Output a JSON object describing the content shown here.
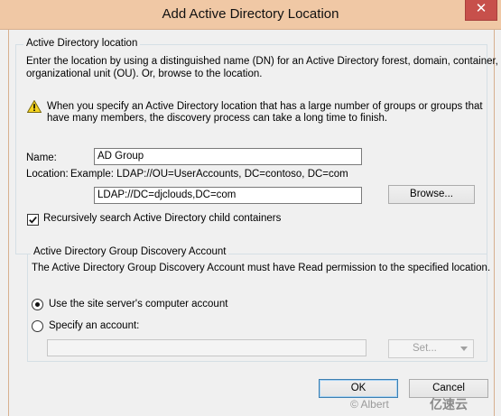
{
  "window": {
    "title": "Add Active Directory Location",
    "close_glyph": "✕"
  },
  "location_group": {
    "legend": "Active Directory location",
    "description_line1": "Enter the location by using a distinguished name (DN) for an Active Directory forest, domain, container, or",
    "description_line2": "organizational unit (OU). Or, browse to the location.",
    "warning_line1": "When you specify an Active Directory location that has a large number of groups or groups that",
    "warning_line2": "have many members, the discovery process can take a long time to finish.",
    "warning_icon": "warning-icon",
    "name_label": "Name:",
    "name_value": "AD Group",
    "location_label": "Location:",
    "location_example": "Example: LDAP://OU=UserAccounts, DC=contoso, DC=com",
    "location_value": "LDAP://DC=djclouds,DC=com",
    "browse_label": "Browse...",
    "recursive_label": "Recursively search Active Directory child containers",
    "recursive_checked": true
  },
  "account_group": {
    "legend": "Active Directory Group Discovery Account",
    "description": "The Active Directory Group Discovery Account must have Read permission to the specified location.",
    "option_site_server": "Use the site server's computer account",
    "option_specify": "Specify an account:",
    "selected": "site_server",
    "account_value": "",
    "set_label": "Set..."
  },
  "buttons": {
    "ok": "OK",
    "cancel": "Cancel"
  },
  "watermark": {
    "left": "© Albert",
    "right": "亿速云"
  }
}
